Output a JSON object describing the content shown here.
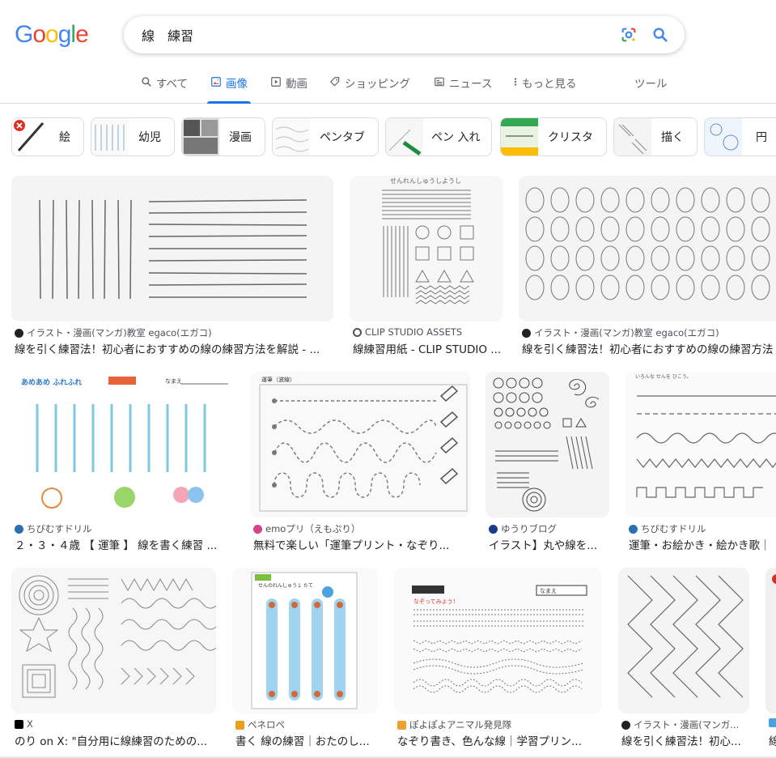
{
  "brand": {
    "logo_letters": [
      "G",
      "o",
      "o",
      "g",
      "l",
      "e"
    ],
    "logo_colors": [
      "#4285F4",
      "#EA4335",
      "#FBBC05",
      "#4285F4",
      "#34A853",
      "#EA4335"
    ]
  },
  "search": {
    "query": "線　練習"
  },
  "tabs": [
    {
      "label": "すべて",
      "icon": "search-icon"
    },
    {
      "label": "画像",
      "icon": "image-icon",
      "active": true
    },
    {
      "label": "動画",
      "icon": "play-icon"
    },
    {
      "label": "ショッピング",
      "icon": "tag-icon"
    },
    {
      "label": "ニュース",
      "icon": "news-icon"
    },
    {
      "label": "もっと見る",
      "icon": "more-vert-icon"
    }
  ],
  "tools_label": "ツール",
  "chips": [
    {
      "label": "絵"
    },
    {
      "label": "幼児"
    },
    {
      "label": "漫画"
    },
    {
      "label": "ペンタブ"
    },
    {
      "label": "ペン 入れ"
    },
    {
      "label": "クリスタ"
    },
    {
      "label": "描く"
    },
    {
      "label": "円"
    }
  ],
  "results": [
    {
      "source": "イラスト・漫画(マンガ)教室 egaco(エガコ)",
      "title": "線を引く練習法！初心者におすすめの線の練習方法を解説 - ..."
    },
    {
      "source": "CLIP STUDIO ASSETS",
      "title": "線練習用紙 - CLIP STUDIO ..."
    },
    {
      "source": "イラスト・漫画(マンガ)教室 egaco(エガコ)",
      "title": "線を引く練習法！初心者におすすめの線の練習方法"
    },
    {
      "source": "ちびむすドリル",
      "title": "２・３・４歳 【 運筆 】 線を書く練習 ..."
    },
    {
      "source": "emoプリ（えもぷり）",
      "title": "無料で楽しい「運筆プリント・なぞり..."
    },
    {
      "source": "ゆうりブログ",
      "title": "イラスト】丸や線を..."
    },
    {
      "source": "ちびむすドリル",
      "title": "運筆・お絵かき・絵かき歌｜"
    },
    {
      "source": "X",
      "title": "のり on X: \"自分用に線練習のための..."
    },
    {
      "source": "ペネロペ",
      "title": "書く 線の練習｜おたのし..."
    },
    {
      "source": "ぽよぽよアニマル発見隊",
      "title": "なぞり書き、色んな線｜学習プリン..."
    },
    {
      "source": "イラスト・漫画(マンガ...",
      "title": "線を引く練習法！初心..."
    },
    {
      "source": "",
      "title": "線"
    }
  ],
  "image_texts": {
    "clip_header": "せんれんしゅうしようし",
    "chibi_header": "あめあめ ふれふれ",
    "chibi_name": "なまえ",
    "emo_header": "運筆（波線）",
    "chibi2_header": "いろんな せんを ひこう。",
    "pene_header": "せんのれんしゅう１ たて",
    "poyo_name": "なまえ",
    "poyo_header": "なぞってみよう！"
  }
}
